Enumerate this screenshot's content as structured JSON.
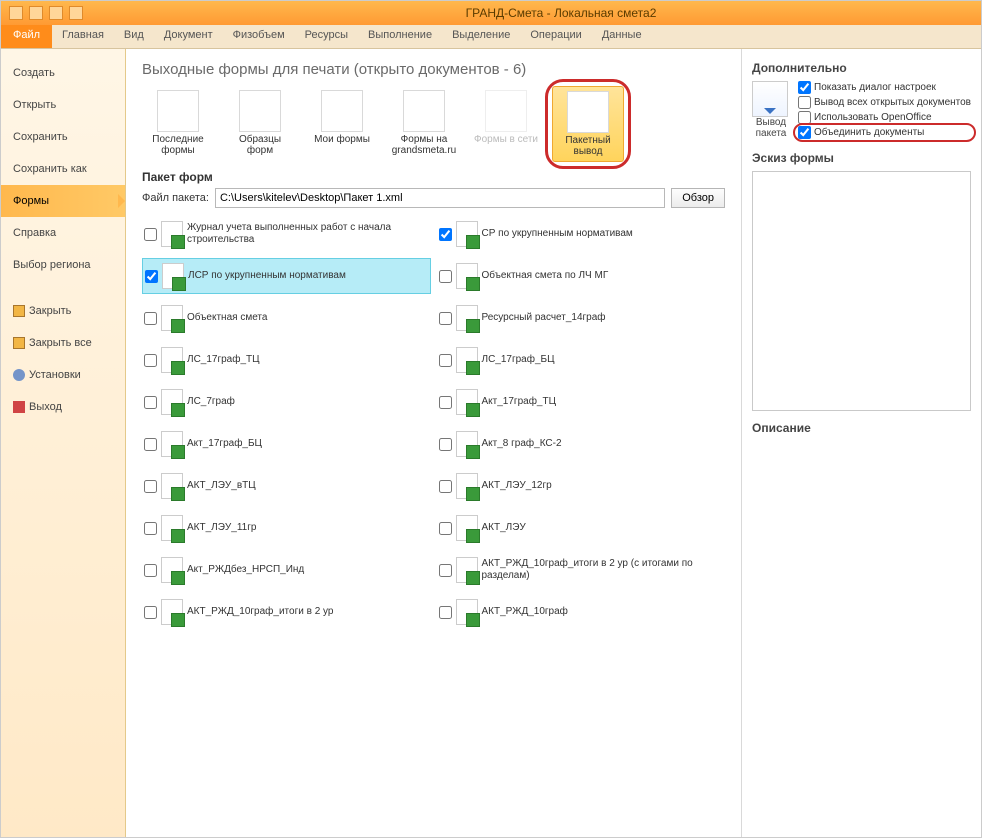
{
  "window_title": "ГРАНД-Смета - Локальная смета2",
  "ribbon": {
    "file": "Файл",
    "tabs": [
      "Главная",
      "Вид",
      "Документ",
      "Физобъем",
      "Ресурсы",
      "Выполнение",
      "Выделение",
      "Операции",
      "Данные"
    ]
  },
  "nav": {
    "create": "Создать",
    "open": "Открыть",
    "save": "Сохранить",
    "save_as": "Сохранить как",
    "forms": "Формы",
    "help": "Справка",
    "region": "Выбор региона",
    "close": "Закрыть",
    "close_all": "Закрыть все",
    "settings": "Установки",
    "exit": "Выход"
  },
  "center": {
    "heading": "Выходные формы для печати (открыто документов - 6)",
    "big": {
      "recent": "Последние формы",
      "samples": "Образцы форм",
      "my": "Мои формы",
      "site": "Формы на grandsmeta.ru",
      "net": "Формы в сети",
      "batch": "Пакетный вывод"
    },
    "section": "Пакет форм",
    "path_label": "Файл пакета:",
    "path_value": "C:\\Users\\kitelev\\Desktop\\Пакет 1.xml",
    "browse": "Обзор",
    "items_left": [
      "Журнал учета выполненных работ с начала строительства",
      "ЛСР по укрупненным нормативам",
      "Объектная смета",
      "ЛС_17граф_ТЦ",
      "ЛС_7граф",
      "Акт_17граф_БЦ",
      "АКТ_ЛЭУ_вТЦ",
      "АКТ_ЛЭУ_11гр",
      "Акт_РЖДбез_НРСП_Инд",
      "АКТ_РЖД_10граф_итоги в 2 ур"
    ],
    "items_right": [
      "СР по укрупненным нормативам",
      "Объектная смета по ЛЧ МГ",
      "Ресурсный расчет_14граф",
      "ЛС_17граф_БЦ",
      "Акт_17граф_ТЦ",
      "Акт_8 граф_КС-2",
      "АКТ_ЛЭУ_12гр",
      "АКТ_ЛЭУ",
      "АКТ_РЖД_10граф_итоги в 2 ур (с итогами по разделам)",
      "АКТ_РЖД_10граф"
    ]
  },
  "right": {
    "h_extra": "Дополнительно",
    "opt_dialog": "Показать диалог настроек",
    "opt_all_docs": "Вывод всех открытых документов",
    "opt_oo": "Использовать OpenOffice",
    "opt_merge": "Объединить документы",
    "opt_caption": "Вывод пакета",
    "h_preview": "Эскиз формы",
    "h_desc": "Описание"
  }
}
